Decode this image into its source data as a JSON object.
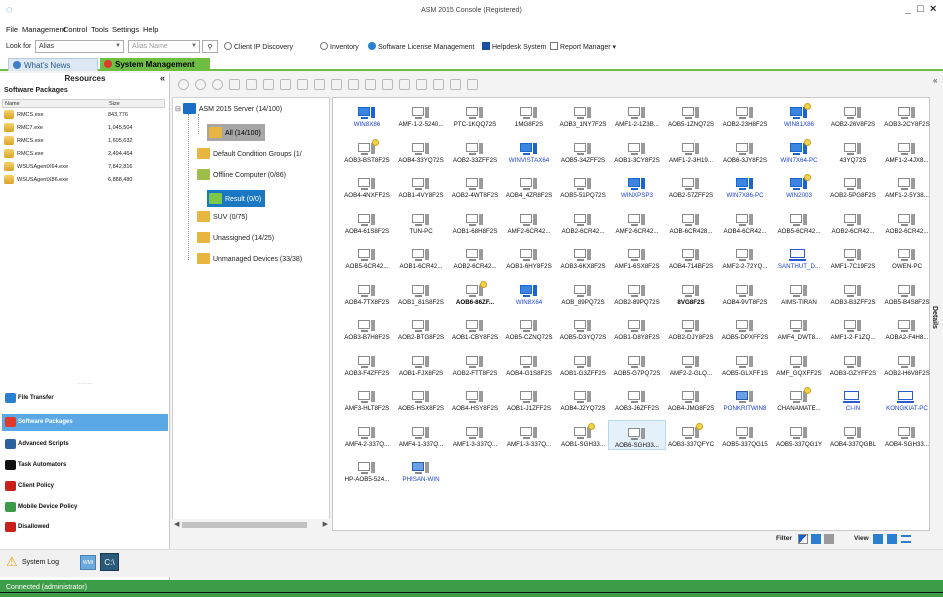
{
  "window": {
    "title": "ASM 2015 Console (Registered)",
    "minimize": "_",
    "maximize": "□",
    "close": "×"
  },
  "menu": [
    "File",
    "Management",
    "Control",
    "Tools",
    "Settings",
    "Help"
  ],
  "toolbar": {
    "look_for_label": "Look for",
    "look_for_value": "Alias",
    "search_placeholder": "Alias Name",
    "client_ip_discovery": "Client IP Discovery",
    "inventory": "Inventory",
    "software_license_management": "Software License Management",
    "helpdesk_system": "Helpdesk System",
    "report_manager": "Report Manager"
  },
  "tabs": [
    {
      "label": "What's News"
    },
    {
      "label": "System Management"
    }
  ],
  "resources": {
    "title": "Resources",
    "subtitle": "Software Packages",
    "columns": [
      "Name",
      "Size"
    ],
    "files": [
      {
        "name": "RMCS.exe",
        "size": "843,776"
      },
      {
        "name": "RMC7.exe",
        "size": "1,045,504"
      },
      {
        "name": "RMCS.exe",
        "size": "1,605,632"
      },
      {
        "name": "RMCS.exe",
        "size": "2,494,464"
      },
      {
        "name": "WSUSAgentX64.exe",
        "size": "7,842,816"
      },
      {
        "name": "WSUSAgentX86.exe",
        "size": "6,888,480"
      }
    ],
    "nav": [
      "File Transfer",
      "Software Packages",
      "Advanced Scripts",
      "Task Automators",
      "Client Policy",
      "Mobile Device Policy",
      "Disallowed"
    ],
    "selected_nav": "Software Packages"
  },
  "tree": {
    "root": "ASM 2015 Server (14/100)",
    "all": "All (14/100)",
    "default_groups": "Default Condition Groups (1/",
    "offline": "Offline Computer (0/86)",
    "result": "Result (0/0)",
    "suv": "SUV (0/75)",
    "unassigned": "Unassigned (14/25)",
    "unmanaged": "Unmanaged Devices (33/38)"
  },
  "computers": [
    [
      "WIN8X86",
      "AMF-1-2-5240...",
      "PTC-1KQQ72S",
      "1MG8F2S",
      "AOB3_1NY7F2S",
      "AMF1-2-1Z3B...",
      "AOB5-1ZNQ72S",
      "AOB2-23H8F2S",
      "WIN81X86",
      "AOB2-26V8F2S",
      "AOB3-2CY8F2S"
    ],
    [
      "AOB3-BST8F2S",
      "AOB4-33YQ72S",
      "AOB2-33ZFF2S",
      "WINVISTAX64",
      "AOB5-34ZFF2S",
      "AOB1-3CY8F2S",
      "AMF1-2-3H19...",
      "AOB6-3JY8F2S",
      "WIN7X64-PC",
      "43YQ72S",
      "AMF1-2-4JX8..."
    ],
    [
      "AOB4-4NXFF2S",
      "AOB1-4VY8F2S",
      "AOB2-4WT8F2S",
      "AOB4_4ZR8F2S",
      "AOB5-51PQ72S",
      "WINXPSP3",
      "AOB2-57ZFF2S",
      "WIN7X86-PC",
      "WIN2003",
      "AOB2-5PG8F2S",
      "AMF1-2-5Y38..."
    ],
    [
      "AOB4-61S8F2S",
      "TUN-PC",
      "AOB1-68H8F2S",
      "AMF2-6CR42...",
      "AOB2-6CR42...",
      "AMF2-6CR42...",
      "AOB-6CR428...",
      "AOB4-6CR42...",
      "AOB5-6CR42...",
      "AOB2-6CR42...",
      "AOB2-6CR42..."
    ],
    [
      "AOB5-6CR42...",
      "AOB1-6CR42...",
      "AOB2-6CR42...",
      "AOB1-6HY8F2S",
      "AOB3-6KX8F2S",
      "AMF1-6SX8F2S",
      "AOB4-714BF2S",
      "AMF2-2-72YQ...",
      "SANTHUT_D...",
      "AMF1-7C19F2S",
      "OWEN-PC"
    ],
    [
      "AOB4-7TX8F2S",
      "AOB1_81S8F2S",
      "AOB6-86ZF...",
      "WIN8X64",
      "AOB_89PQ72S",
      "AOB2-89PQ72S",
      "8VG8F2S",
      "AOB4-9VT8F2S",
      "AIMS-TIRAN",
      "AOB3-B3ZFF2S",
      "AOB5-B4S8F2S"
    ],
    [
      "AOB3-B7H8F2S",
      "AOB2-BTG8F2S",
      "AOB1-CBY8F2S",
      "AOB5-CZNQ72S",
      "AOB5-D3YQ72S",
      "AOB1-D8Y8F2S",
      "AOB2-DJY8F2S",
      "AOB5-DPXFF2S",
      "AMF4_DWT8...",
      "AMF1-2-F1ZQ...",
      "AOBA2-F4H8..."
    ],
    [
      "AOB3-F4ZFF2S",
      "AOB1-FJX8F2S",
      "AOB2-FTT8F2S",
      "AOB4-G1S8F2S",
      "AOB1-G3ZFF2S",
      "AOB5-G7PQ72S",
      "AMF2-2-GLQ...",
      "AOB5-GLXFF1S",
      "AMF_GQXFF2S",
      "AOB3-GZYFF2S",
      "AOB2-H6V8F2S"
    ],
    [
      "AMF3-HLT8F2S",
      "AOB5-HSX8F2S",
      "AOB4-HSY8F2S",
      "AOB1-J1ZFF2S",
      "AOB4-J2YQ72S",
      "AOB3-J6ZFF2S",
      "AOB4-JMG8F2S",
      "PONKRITWIN8",
      "CHANAMATE...",
      "CI-IN",
      "KONGKIAT-PC"
    ],
    [
      "AMF4-2-337Q...",
      "AMF4-1-337Q...",
      "AMF1-3-337Q...",
      "AMF1-3-337Q...",
      "AOB1-SGH33...",
      "AOB6-SGH33...",
      "AOB3-337QFYC",
      "AOB5-337QG15",
      "AOB5-337QG1Y",
      "AOB4-337QGBL",
      "AOB4-SGH33..."
    ],
    [
      "HP-AOB5-524...",
      "PHISAN-WIN"
    ]
  ],
  "filter_label": "Filter",
  "view_label": "View",
  "details_label": "Details",
  "bottom": {
    "system_log": "System Log",
    "button1": "WMI",
    "button2": "C:\\"
  },
  "status": "Connected (administrator)"
}
